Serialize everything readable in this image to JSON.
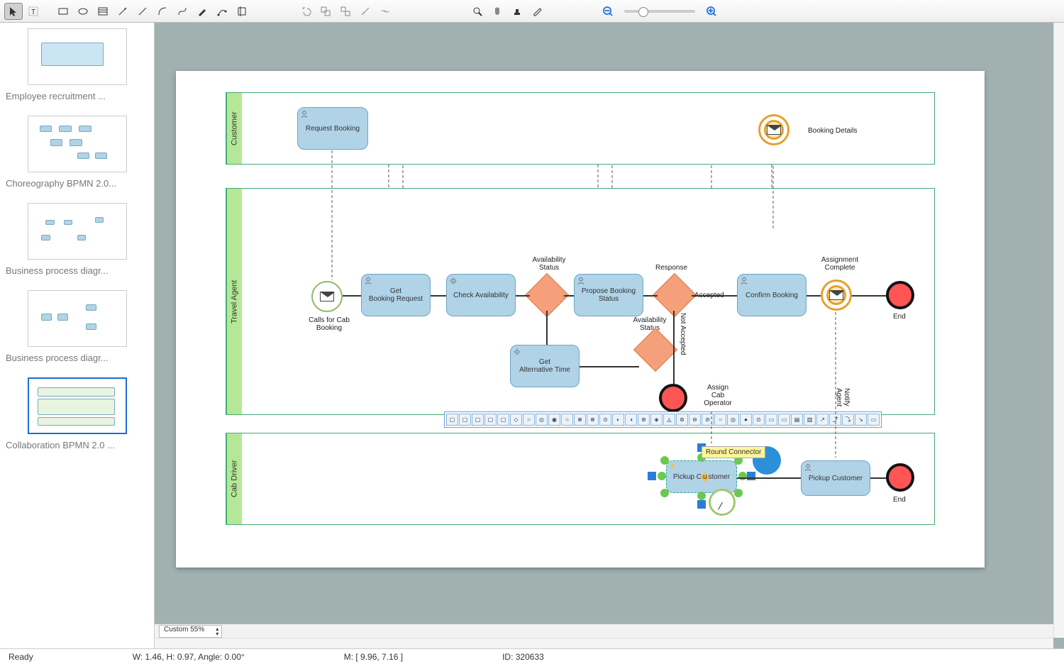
{
  "toolbar": {
    "tools": [
      "pointer",
      "text",
      "rect",
      "ellipse",
      "table",
      "arrow",
      "line",
      "curve",
      "bezier",
      "pen",
      "node-edit",
      "crop"
    ],
    "edit_tools": [
      "undo",
      "group",
      "ungroup",
      "align",
      "distribute"
    ],
    "view_tools": [
      "zoom",
      "hand",
      "stamp",
      "eyedrop"
    ],
    "zoom_tools": [
      "zoom-out",
      "zoom-in"
    ]
  },
  "sidebar": {
    "items": [
      {
        "label": "Employee recruitment ..."
      },
      {
        "label": "Choreography BPMN 2.0..."
      },
      {
        "label": "Business process diagr..."
      },
      {
        "label": "Business process diagr..."
      },
      {
        "label": "Collaboration BPMN 2.0 ..."
      }
    ]
  },
  "diagram": {
    "pools": [
      {
        "name": "Customer"
      },
      {
        "name": "Travel Agent"
      },
      {
        "name": "Cab Driver"
      }
    ],
    "tasks": {
      "request_booking": "Request Booking",
      "get_booking_request": "Get\nBooking Request",
      "check_availability": "Check Availability",
      "propose_booking_status": "Propose Booking Status",
      "confirm_booking": "Confirm Booking",
      "get_alternative_time": "Get\nAlternative Time",
      "pickup_customer_sel": "Pickup Customer",
      "pickup_customer": "Pickup Customer"
    },
    "labels": {
      "booking_details": "Booking Details",
      "availability_status": "Availability Status",
      "availability_status2": "Availability\nStatus",
      "response": "Response",
      "accepted": "Accepted",
      "not_accepted": "Not Accepted",
      "assignment_complete": "Assignment\nComplete",
      "calls_for": "Calls for\nCab Booking",
      "assign_cab": "Assign\nCab\nOperator",
      "notify_agent": "Notify Agent",
      "end1": "End",
      "end2": "End"
    },
    "tooltip": "Round Connector",
    "shape_bar_count": 34
  },
  "bottombar": {
    "zoom": "Custom 55%"
  },
  "status": {
    "ready": "Ready",
    "dims": "W: 1.46,  H: 0.97,  Angle: 0.00°",
    "mouse": "M: [ 9.96, 7.16 ]",
    "id": "ID: 320633"
  }
}
